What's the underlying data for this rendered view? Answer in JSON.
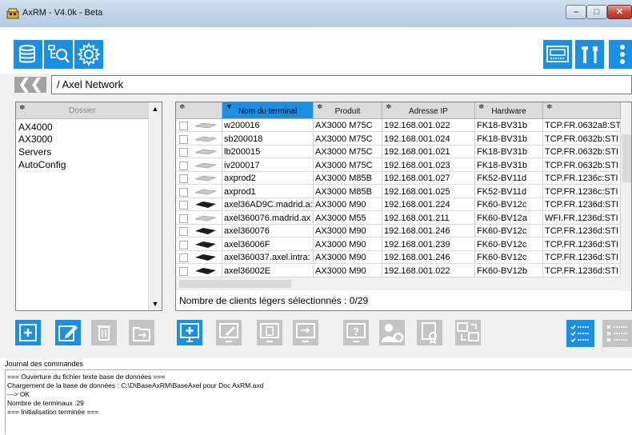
{
  "window": {
    "title": "AxRM - V4.0k - Beta",
    "controls": {
      "minimize": "–",
      "maximize": "□",
      "close": "✕"
    }
  },
  "toolbar": {
    "left_buttons": [
      "database-icon",
      "network-search-icon",
      "settings-gear-icon"
    ],
    "right_buttons": [
      "monitor-icon",
      "tools-icon",
      "more-vertical-icon"
    ],
    "accent": "#1a8fe6"
  },
  "path": {
    "back_label": "❮❮",
    "current": "/ Axel Network"
  },
  "folders": {
    "header": "Dossier",
    "sort_glyph": "≑",
    "items": [
      "AX4000",
      "AX3000",
      "Servers",
      "AutoConfig"
    ],
    "scroll_up": "▲",
    "scroll_down": "▼"
  },
  "table": {
    "sort_glyph": "≑",
    "active_glyph": "▼",
    "columns": [
      "",
      "Nom du terminal",
      "Produit",
      "Adresse IP",
      "Hardware",
      ""
    ],
    "rows": [
      {
        "icon": "thin-client-flat-icon",
        "name": "w200016",
        "product": "AX3000 M75C",
        "ip": "192.168.001.022",
        "hardware": "FK18-BV31b",
        "firmware": "TCP.FR.0632a8:ST"
      },
      {
        "icon": "thin-client-flat-icon",
        "name": "sb200018",
        "product": "AX3000 M75C",
        "ip": "192.168.001.024",
        "hardware": "FK18-BV31b",
        "firmware": "TCP.FR.0632b:STI"
      },
      {
        "icon": "thin-client-flat-icon",
        "name": "lb200015",
        "product": "AX3000 M75C",
        "ip": "192.168.001.021",
        "hardware": "FK18-BV31b",
        "firmware": "TCP.FR.0632b:STI"
      },
      {
        "icon": "thin-client-flat-icon",
        "name": "iv200017",
        "product": "AX3000 M75C",
        "ip": "192.168.001.023",
        "hardware": "FK18-BV31b",
        "firmware": "TCP.FR.0632b:STI"
      },
      {
        "icon": "thin-client-flat-icon",
        "name": "axprod2",
        "product": "AX3000 M85B",
        "ip": "192.168.001.027",
        "hardware": "FK52-BV11d",
        "firmware": "TCP.FR.1236c:STI"
      },
      {
        "icon": "thin-client-flat-icon",
        "name": "axprod1",
        "product": "AX3000 M85B",
        "ip": "192.168.001.025",
        "hardware": "FK52-BV11d",
        "firmware": "TCP.FR.1236c:STI"
      },
      {
        "icon": "thin-client-black-icon",
        "name": "axel36AD9C.madrid.a:",
        "product": "AX3000 M90",
        "ip": "192.168.001.224",
        "hardware": "FK60-BV12c",
        "firmware": "TCP.FR.1236d:STI"
      },
      {
        "icon": "thin-client-flat-icon",
        "name": "axel360076.madrid.ax",
        "product": "AX3000 M55",
        "ip": "192.168.001.211",
        "hardware": "FK60-BV12a",
        "firmware": "WFI.FR.1236d:STI"
      },
      {
        "icon": "thin-client-black-icon",
        "name": "axel360076",
        "product": "AX3000 M90",
        "ip": "192.168.001.246",
        "hardware": "FK60-BV12c",
        "firmware": "TCP.FR.1236d:STI"
      },
      {
        "icon": "thin-client-black-icon",
        "name": "axel36006F",
        "product": "AX3000 M90",
        "ip": "192.168.001.239",
        "hardware": "FK60-BV12c",
        "firmware": "TCP.FR.1236d:STI"
      },
      {
        "icon": "thin-client-black-icon",
        "name": "axel360037.axel.intra:",
        "product": "AX3000 M90",
        "ip": "192.168.001.246",
        "hardware": "FK60-BV12c",
        "firmware": "TCP.FR.1236d:STI"
      },
      {
        "icon": "thin-client-black-icon",
        "name": "axel36002E",
        "product": "AX3000 M90",
        "ip": "192.168.001.022",
        "hardware": "FK60-BV12b",
        "firmware": "TCP.FR.1236d:STI"
      }
    ],
    "status": "Nombre de clients légers sélectionnés : 0/29"
  },
  "actions": {
    "folder_buttons": [
      "add-folder-icon",
      "edit-folder-icon",
      "delete-folder-icon",
      "move-folder-icon"
    ],
    "terminal_buttons": [
      "add-terminal-icon",
      "edit-terminal-icon",
      "delete-terminal-icon",
      "move-terminal-icon",
      "help-terminal-icon",
      "user-settings-icon",
      "certificate-icon",
      "transfer-icon"
    ],
    "select_buttons": [
      "select-all-icon",
      "deselect-all-icon"
    ]
  },
  "journal": {
    "title": "Journal des commandes",
    "lines": [
      "=== Ouverture du fichier texte base de données ===",
      "Chargement de la base de données : C:\\D\\BaseAxRM\\BaseAxel pour Doc AxRM.axd",
      "   ---> OK",
      "Nombre de terminaux :29",
      "=== Initialisation terminée ==="
    ]
  }
}
